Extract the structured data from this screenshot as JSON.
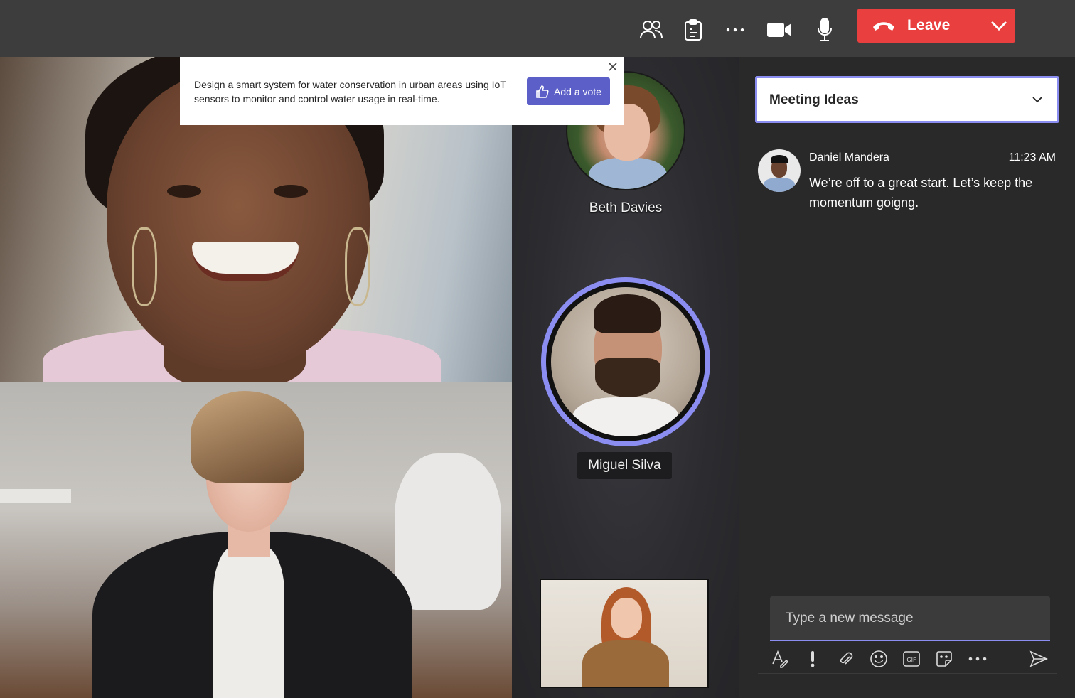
{
  "toolbar": {
    "icons": [
      "people-icon",
      "clipboard-icon",
      "more-icon",
      "camera-icon",
      "mic-icon"
    ],
    "leave_label": "Leave",
    "leave_color": "#ea3f3f"
  },
  "notice": {
    "text": "Design a smart system for water conservation in urban areas using IoT sensors to monitor and control water usage in real-time.",
    "vote_label": "Add a vote",
    "vote_color": "#5b5fc7"
  },
  "participants": {
    "beth": "Beth Davies",
    "miguel": "Miguel Silva",
    "active_ring_color": "#8b8ef0"
  },
  "chat": {
    "title": "Meeting Ideas",
    "message": {
      "author": "Daniel Mandera",
      "time": "11:23 AM",
      "text": "We’re off to a great start. Let’s keep the momentum goigng."
    },
    "composer_placeholder": "Type a new message",
    "tools": [
      "format-icon",
      "important-icon",
      "attach-icon",
      "emoji-icon",
      "gif-icon",
      "sticker-icon",
      "more-icon",
      "send-icon"
    ]
  }
}
